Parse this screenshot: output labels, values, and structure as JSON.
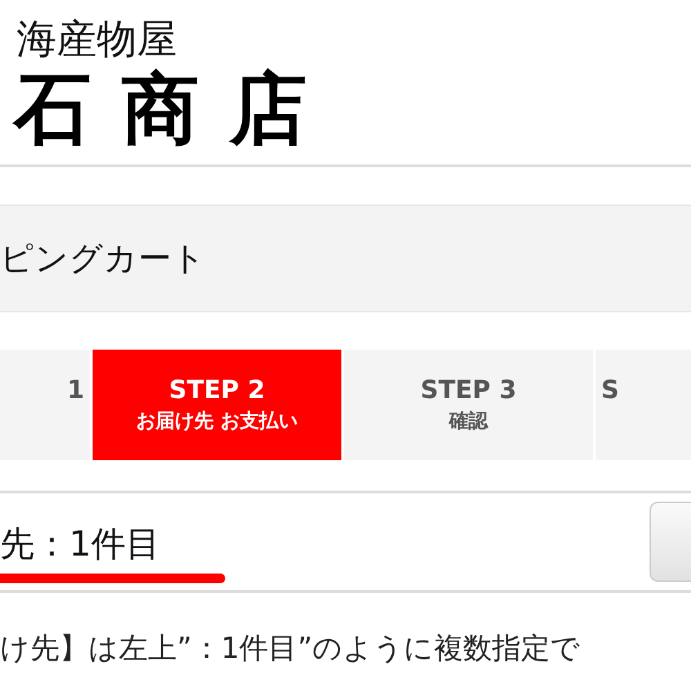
{
  "logo": {
    "tagline": "海産物屋",
    "name": "石商店"
  },
  "page_title": "ピングカート",
  "steps": [
    {
      "title": "1",
      "selected": false
    },
    {
      "title": "STEP 2",
      "subtitle": "お届け先 お支払い",
      "selected": true
    },
    {
      "title": "STEP 3",
      "subtitle": "確認",
      "selected": false
    },
    {
      "title": "S",
      "selected": false
    }
  ],
  "destination": {
    "label": "先：1件目",
    "underlined": true
  },
  "note": "け先】は左上”：1件目”のように複数指定で"
}
